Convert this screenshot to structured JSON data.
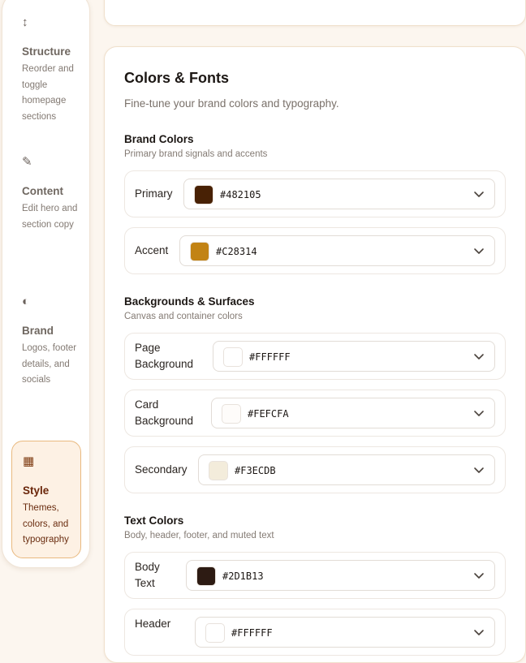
{
  "sidebar": {
    "items": [
      {
        "icon": "↕",
        "icon_name": "reorder-arrows-icon",
        "title": "Structure",
        "desc": "Reorder and toggle homepage sections"
      },
      {
        "icon": "✎",
        "icon_name": "pencil-icon",
        "title": "Content",
        "desc": "Edit hero and section copy"
      },
      {
        "icon": "◐",
        "icon_name": "half-circle-icon",
        "title": "Brand",
        "desc": "Logos, footer details, and socials"
      },
      {
        "icon": "▦",
        "icon_name": "grid-icon",
        "title": "Style",
        "desc": "Themes, colors, and typography",
        "active": true
      }
    ]
  },
  "panel": {
    "title": "Colors & Fonts",
    "subtitle": "Fine-tune your brand colors and typography."
  },
  "groups": {
    "brand": {
      "title": "Brand Colors",
      "desc": "Primary brand signals and accents"
    },
    "backgrounds": {
      "title": "Backgrounds & Surfaces",
      "desc": "Canvas and container colors"
    },
    "text": {
      "title": "Text Colors",
      "desc": "Body, header, footer, and muted text"
    }
  },
  "colors": {
    "primary": {
      "label": "Primary",
      "value": "#482105"
    },
    "accent": {
      "label": "Accent",
      "value": "#C28314"
    },
    "page_background": {
      "label": "Page Background",
      "value": "#FFFFFF"
    },
    "card_background": {
      "label": "Card Background",
      "value": "#FEFCFA"
    },
    "secondary": {
      "label": "Secondary",
      "value": "#F3ECDB"
    },
    "body_text": {
      "label": "Body Text",
      "value": "#2D1B13"
    },
    "header_text": {
      "label": "Header",
      "value": "#FFFFFF"
    }
  },
  "theme": {
    "active_border": "#E9B97F",
    "active_bg": "#FDF1E4",
    "active_text": "#6A260A"
  }
}
